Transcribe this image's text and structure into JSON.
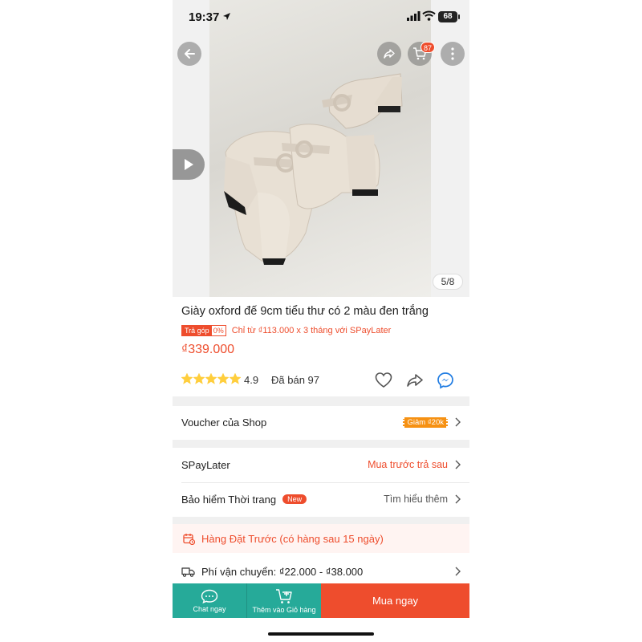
{
  "status_bar": {
    "time": "19:37",
    "battery": "68"
  },
  "hero": {
    "image_counter": "5/8",
    "cart_count": "87"
  },
  "product": {
    "title": "Giày oxford đế 9cm tiểu thư có 2 màu đen trắng",
    "installment": {
      "tag_label": "Trả góp",
      "tag_rate": "0%",
      "text": "Chỉ từ ₫113.000 x 3 tháng với SPayLater"
    },
    "price": "₫339.000",
    "rating": {
      "value": "4.9",
      "stars": 4.9,
      "sold": "Đã bán 97"
    }
  },
  "rows": {
    "voucher": {
      "label": "Voucher của Shop",
      "tag": "Giảm ₫20k"
    },
    "spaylater": {
      "label": "SPayLater",
      "action": "Mua trước trả sau"
    },
    "insurance": {
      "label": "Bảo hiểm Thời trang",
      "badge": "New",
      "action": "Tìm hiểu thêm"
    }
  },
  "preorder": {
    "text": "Hàng Đặt Trước (có hàng sau 15 ngày)"
  },
  "shipping": {
    "text": "Phí vận chuyển: ₫22.000 - ₫38.000"
  },
  "bottom_bar": {
    "chat": "Chat ngay",
    "add_to_cart": "Thêm vào Giỏ hàng",
    "buy_now": "Mua ngay"
  },
  "colors": {
    "accent": "#ee4d2d",
    "teal": "#26aa99",
    "voucher": "#f69113",
    "star": "#ffce3d"
  }
}
